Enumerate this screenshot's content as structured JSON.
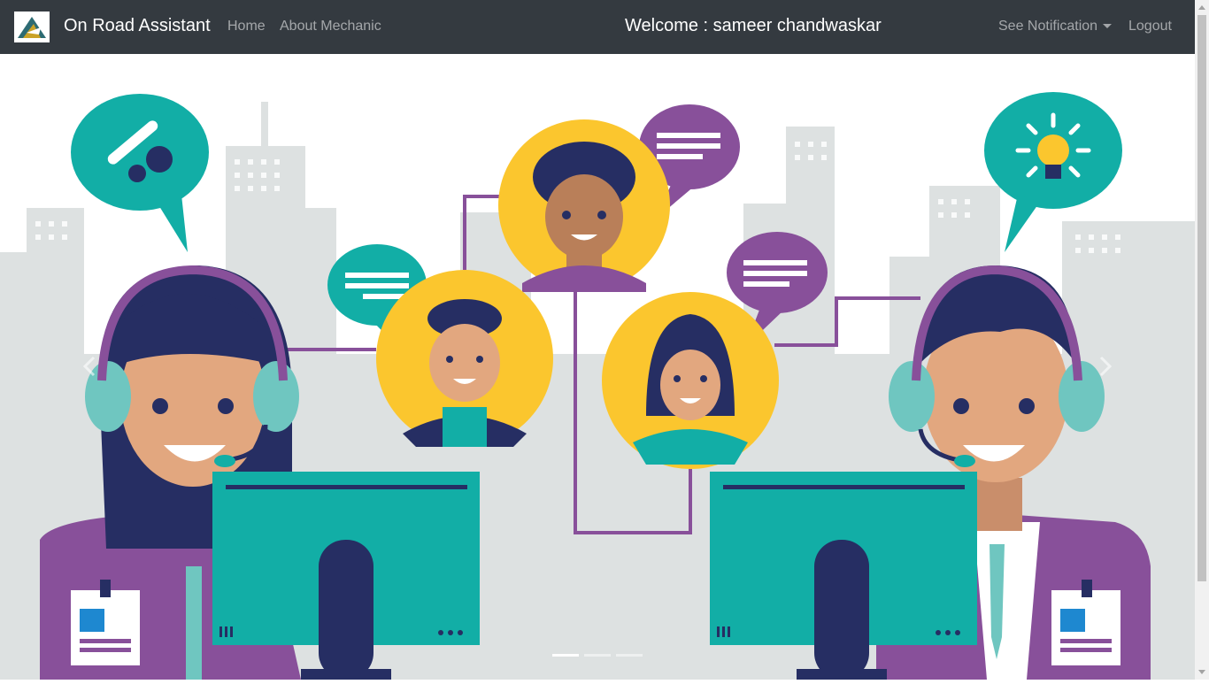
{
  "navbar": {
    "brand": "On Road Assistant",
    "links": [
      "Home",
      "About Mechanic"
    ],
    "welcome": "Welcome : sameer chandwaskar",
    "notification_label": "See Notification",
    "logout_label": "Logout"
  },
  "carousel": {
    "indicator_count": 3,
    "active_indicator": 0
  },
  "colors": {
    "navbar_bg": "#343a40",
    "teal": "#12aea6",
    "purple": "#88509a",
    "yellow": "#fbc62e",
    "navy": "#262e63",
    "skin": "#e2a77f"
  }
}
